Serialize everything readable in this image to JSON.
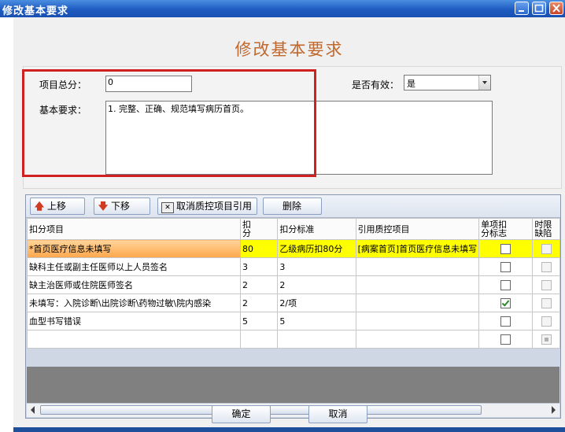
{
  "window": {
    "title": "修改基本要求"
  },
  "form": {
    "heading": "修改基本要求",
    "total_score_label": "项目总分：",
    "total_score_value": "0",
    "valid_label": "是否有效：",
    "valid_value": "是",
    "requirement_label": "基本要求：",
    "requirement_value": "1. 完整、正确、规范填写病历首页。"
  },
  "toolbar": {
    "move_up": "上移",
    "move_down": "下移",
    "cancel_ref": "取消质控项目引用",
    "delete": "删除"
  },
  "table": {
    "columns": [
      "扣分项目",
      "扣分",
      "扣分标准",
      "引用质控项目",
      "单项扣分标志",
      "时限缺陷"
    ],
    "column_lines": [
      [
        "扣分项目"
      ],
      [
        "扣",
        "分"
      ],
      [
        "扣分标准"
      ],
      [
        "引用质控项目"
      ],
      [
        "单项扣",
        "分标志"
      ],
      [
        "时限",
        "缺陷"
      ]
    ],
    "rows": [
      {
        "item": "*首页医疗信息未填写",
        "deduct": "80",
        "standard": "乙级病历扣80分",
        "ref": "[病案首页]首页医疗信息未填写",
        "single": false,
        "limit": false,
        "selected": true
      },
      {
        "item": "缺科主任或副主任医师以上人员签名",
        "deduct": "3",
        "standard": "3",
        "ref": "",
        "single": false,
        "limit": false,
        "selected": false
      },
      {
        "item": "缺主治医师或住院医师签名",
        "deduct": "2",
        "standard": "2",
        "ref": "",
        "single": false,
        "limit": false,
        "selected": false
      },
      {
        "item": "未填写：入院诊断\\出院诊断\\药物过敏\\院内感染",
        "deduct": "2",
        "standard": "2/项",
        "ref": "",
        "single": true,
        "limit": false,
        "selected": false
      },
      {
        "item": "血型书写错误",
        "deduct": "5",
        "standard": "5",
        "ref": "",
        "single": false,
        "limit": false,
        "selected": false
      },
      {
        "item": "",
        "deduct": "",
        "standard": "",
        "ref": "",
        "single": false,
        "limit": "indeterminate",
        "selected": false
      }
    ]
  },
  "buttons": {
    "ok": "确定",
    "cancel": "取消"
  },
  "colors": {
    "title_bar": "#1e5bc0",
    "heading": "#c0682e",
    "selected_row": "#ffff00",
    "annotation_box": "#d02020"
  }
}
